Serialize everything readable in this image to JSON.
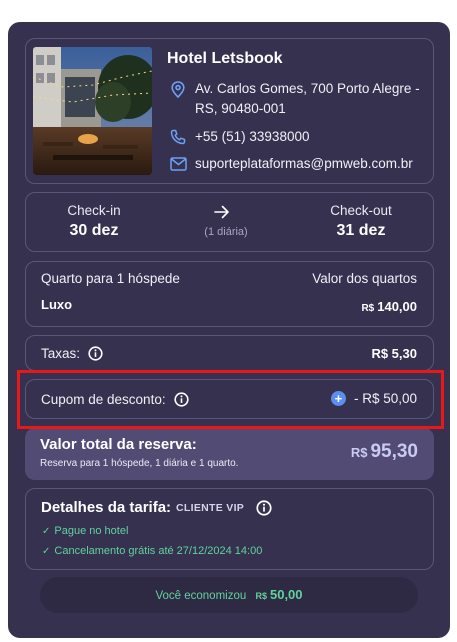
{
  "hotel": {
    "name": "Hotel Letsbook",
    "address": "Av. Carlos Gomes, 700 Porto Alegre - RS, 90480-001",
    "phone": "+55 (51) 33938000",
    "email": "suporteplataformas@pmweb.com.br"
  },
  "stay": {
    "checkin_label": "Check-in",
    "checkin_date": "30 dez",
    "nights": "(1 diária)",
    "checkout_label": "Check-out",
    "checkout_date": "31 dez"
  },
  "room": {
    "type_label": "Quarto para 1 hóspede",
    "value_label": "Valor dos quartos",
    "name": "Luxo",
    "currency": "R$",
    "price": "140,00"
  },
  "taxes": {
    "label": "Taxas:",
    "value": "R$ 5,30"
  },
  "coupon": {
    "label": "Cupom de desconto:",
    "add_symbol": "+",
    "value": "- R$ 50,00"
  },
  "total": {
    "title": "Valor total da reserva:",
    "subtitle": "Reserva para 1 hóspede, 1 diária  e 1 quarto.",
    "currency": "R$",
    "value": "95,30"
  },
  "fare": {
    "title": "Detalhes da tarifa:",
    "tag": "CLIENTE VIP",
    "items": [
      "Pague no hotel",
      "Cancelamento grátis até 27/12/2024 14:00"
    ]
  },
  "savings": {
    "label": "Você economizou",
    "currency": "R$",
    "value": "50,00"
  },
  "colors": {
    "panel": "#373150",
    "accent_green": "#5fd39e",
    "accent_blue": "#5b8ef0",
    "highlight": "#e81818"
  }
}
